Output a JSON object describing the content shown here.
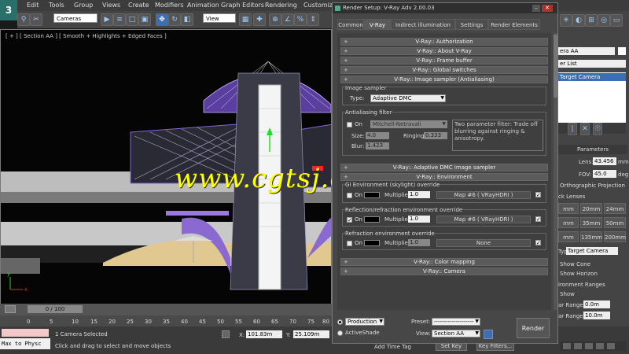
{
  "menubar": {
    "logo": "3",
    "items": [
      "Edit",
      "Tools",
      "Group",
      "Views",
      "Create",
      "Modifiers",
      "Animation",
      "Graph Editors",
      "Rendering",
      "Customiz"
    ]
  },
  "toolbar": {
    "selection_filter": "Cameras",
    "ref_coord": "View"
  },
  "viewport": {
    "label": "[ + ] [ Section AA ] [ Smooth + Highlights + Edged Faces ]",
    "axis_y": "y",
    "axis_x": "x"
  },
  "watermark": "www.cgtsj.com",
  "timeline": {
    "slider": "0 / 100",
    "ticks": [
      "0",
      "5",
      "10",
      "15",
      "20",
      "25",
      "30",
      "35",
      "40",
      "45",
      "50",
      "55",
      "60",
      "65",
      "70",
      "75",
      "80"
    ]
  },
  "status": {
    "maxscript": "Max to Physc",
    "selected": "1 Camera Selected",
    "hint": "Click and drag to select and move objects",
    "x_label": "X:",
    "x_value": "101.83m",
    "y_label": "Y:",
    "y_value": "25.109m",
    "add_time_tag": "Add Time Tag",
    "set_key": "Set Key",
    "key_filters": "Key Filters..."
  },
  "cmdpanel": {
    "name_field": "era AA",
    "modifier_list": "er List",
    "stack_item": "Target Camera",
    "parameters": "Parameters",
    "lens_label": "Lens:",
    "lens_value": "43.456",
    "lens_unit": "mm",
    "fov_label": "FOV:",
    "fov_value": "45.0",
    "fov_unit": "deg.",
    "ortho": "Orthographic Projection",
    "stock_lenses": "ck Lenses",
    "lenses": [
      "mm",
      "20mm",
      "24mm",
      "mm",
      "35mm",
      "50mm",
      "mm",
      "135mm",
      "200mm"
    ],
    "type_label": "Type:",
    "type_value": "Target Camera",
    "show_cone": "Show Cone",
    "show_horizon": "Show Horizon",
    "env_ranges": "ironment Ranges",
    "show": "Show",
    "near_range": "ar Range:",
    "near_value": "0.0m",
    "far_range": "ar Range:",
    "far_value": "10.0m"
  },
  "dialog": {
    "title": "Render Setup: V-Ray Adv 2.00.03",
    "tabs": [
      "Common",
      "V-Ray",
      "Indirect illumination",
      "Settings",
      "Render Elements"
    ],
    "rollouts_top": [
      "V-Ray:: Authorization",
      "V-Ray:: About V-Ray",
      "V-Ray:: Frame buffer",
      "V-Ray:: Global switches",
      "V-Ray:: Image sampler (Antialiasing)"
    ],
    "image_sampler_group": "Image sampler",
    "type_label": "Type:",
    "type_value": "Adaptive DMC",
    "aa_group": "Antialiasing filter",
    "aa_on": "On",
    "aa_filter": "Mitchell-Netravali",
    "aa_desc": "Two parameter filter: Trade off blurring against ringing & anisotropy.",
    "size_label": "Size:",
    "size_value": "4.0",
    "ringing_label": "Ringing:",
    "ringing_value": "0.333",
    "blur_label": "Blur:",
    "blur_value": "1.423",
    "dmc_rollout": "V-Ray:: Adaptive DMC image sampler",
    "env_rollout": "V-Ray:: Environment",
    "gi_group": "GI Environment (skylight) override",
    "gi_on": "On",
    "gi_mult_label": "Multiplier:",
    "gi_mult": "1.0",
    "gi_map": "Map #6  ( VRayHDRI )",
    "refl_group": "Reflection/refraction environment override",
    "refl_on": "On",
    "refl_mult_label": "Multiplier:",
    "refl_mult": "1.0",
    "refl_map": "Map #6  ( VRayHDRI )",
    "refr_group": "Refraction environment override",
    "refr_on": "On",
    "refr_mult_label": "Multiplier:",
    "refr_mult": "1.0",
    "refr_map": "None",
    "rollouts_bottom": [
      "V-Ray:: Color mapping",
      "V-Ray:: Camera"
    ],
    "production": "Production",
    "activeshade": "ActiveShade",
    "preset_label": "Preset:",
    "preset_value": "--------------------",
    "view_label": "View:",
    "view_value": "Section AA",
    "render": "Render",
    "plusminus": "+"
  }
}
